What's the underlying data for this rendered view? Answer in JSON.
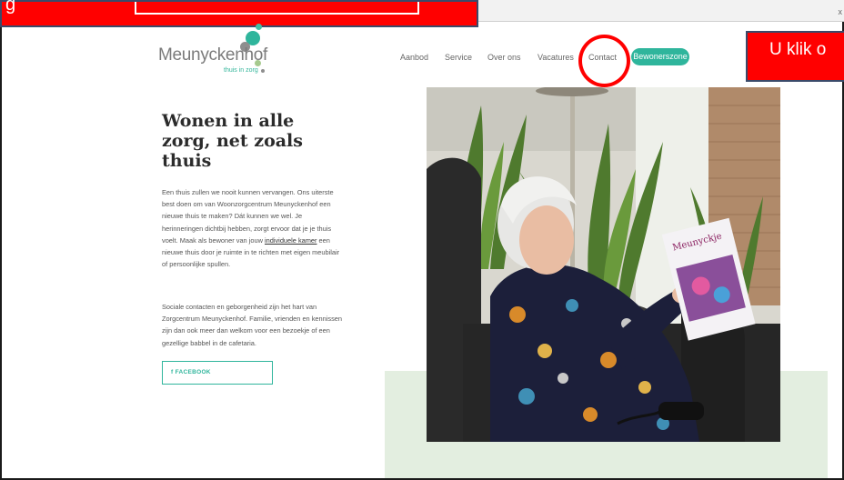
{
  "annotation": {
    "left_partial_text": "g",
    "right_text": "U klik o",
    "close_glyph": "x"
  },
  "logo": {
    "name": "Meunyckenhof",
    "tagline": "thuis in zorg"
  },
  "nav": {
    "items": [
      "Aanbod",
      "Service",
      "Over ons",
      "Vacatures",
      "Contact"
    ],
    "cta": "Bewonerszone"
  },
  "hero": {
    "title": "Wonen in alle zorg, net zoals thuis",
    "p1_before": "Een thuis zullen we nooit kunnen vervangen. Ons uiterste best doen om van Woonzorgcentrum Meunyckenhof een nieuwe thuis te maken? Dát kunnen we wel. Je herinneringen dichtbij hebben, zorgt ervoor dat je je thuis voelt. Maak als bewoner van jouw ",
    "p1_link": "individuele kamer",
    "p1_after": " een nieuwe thuis door je ruimte in te richten met eigen meubilair of persoonlijke spullen.",
    "p2": "Sociale contacten en geborgenheid zijn het hart van Zorgcentrum Meunyckenhof. Familie, vrienden en kennissen zijn dan ook meer dan welkom voor een bezoekje of een gezellige babbel in de cafetaria.",
    "facebook": "f  FACEBOOK"
  },
  "photo": {
    "magazine_title": "Meunyckje"
  },
  "colors": {
    "accent": "#2fb59c",
    "annotation_red": "#ff0000",
    "green_panel": "#e3eee0"
  }
}
